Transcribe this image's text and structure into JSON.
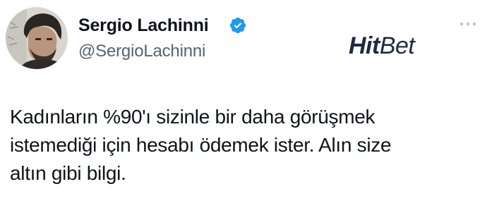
{
  "author": {
    "display_name": "Sergio Lachinni",
    "handle": "@SergioLachinni",
    "verified": true,
    "avatar_icon": "profile-photo"
  },
  "brand": {
    "name_bold": "Hit",
    "name_light": "Bet",
    "color": "#1f2a44"
  },
  "tweet": {
    "lines": [
      "Kadınların %90'ı sizinle bir daha görüşmek",
      "istemediği için hesabı ödemek ister. Alın size",
      "altın gibi bilgi."
    ]
  },
  "icons": {
    "verified": "verified-badge-icon",
    "more": "more-options-icon"
  },
  "colors": {
    "verified_blue": "#1d9bf0",
    "text": "#0f1419",
    "secondary_text": "#536471"
  }
}
